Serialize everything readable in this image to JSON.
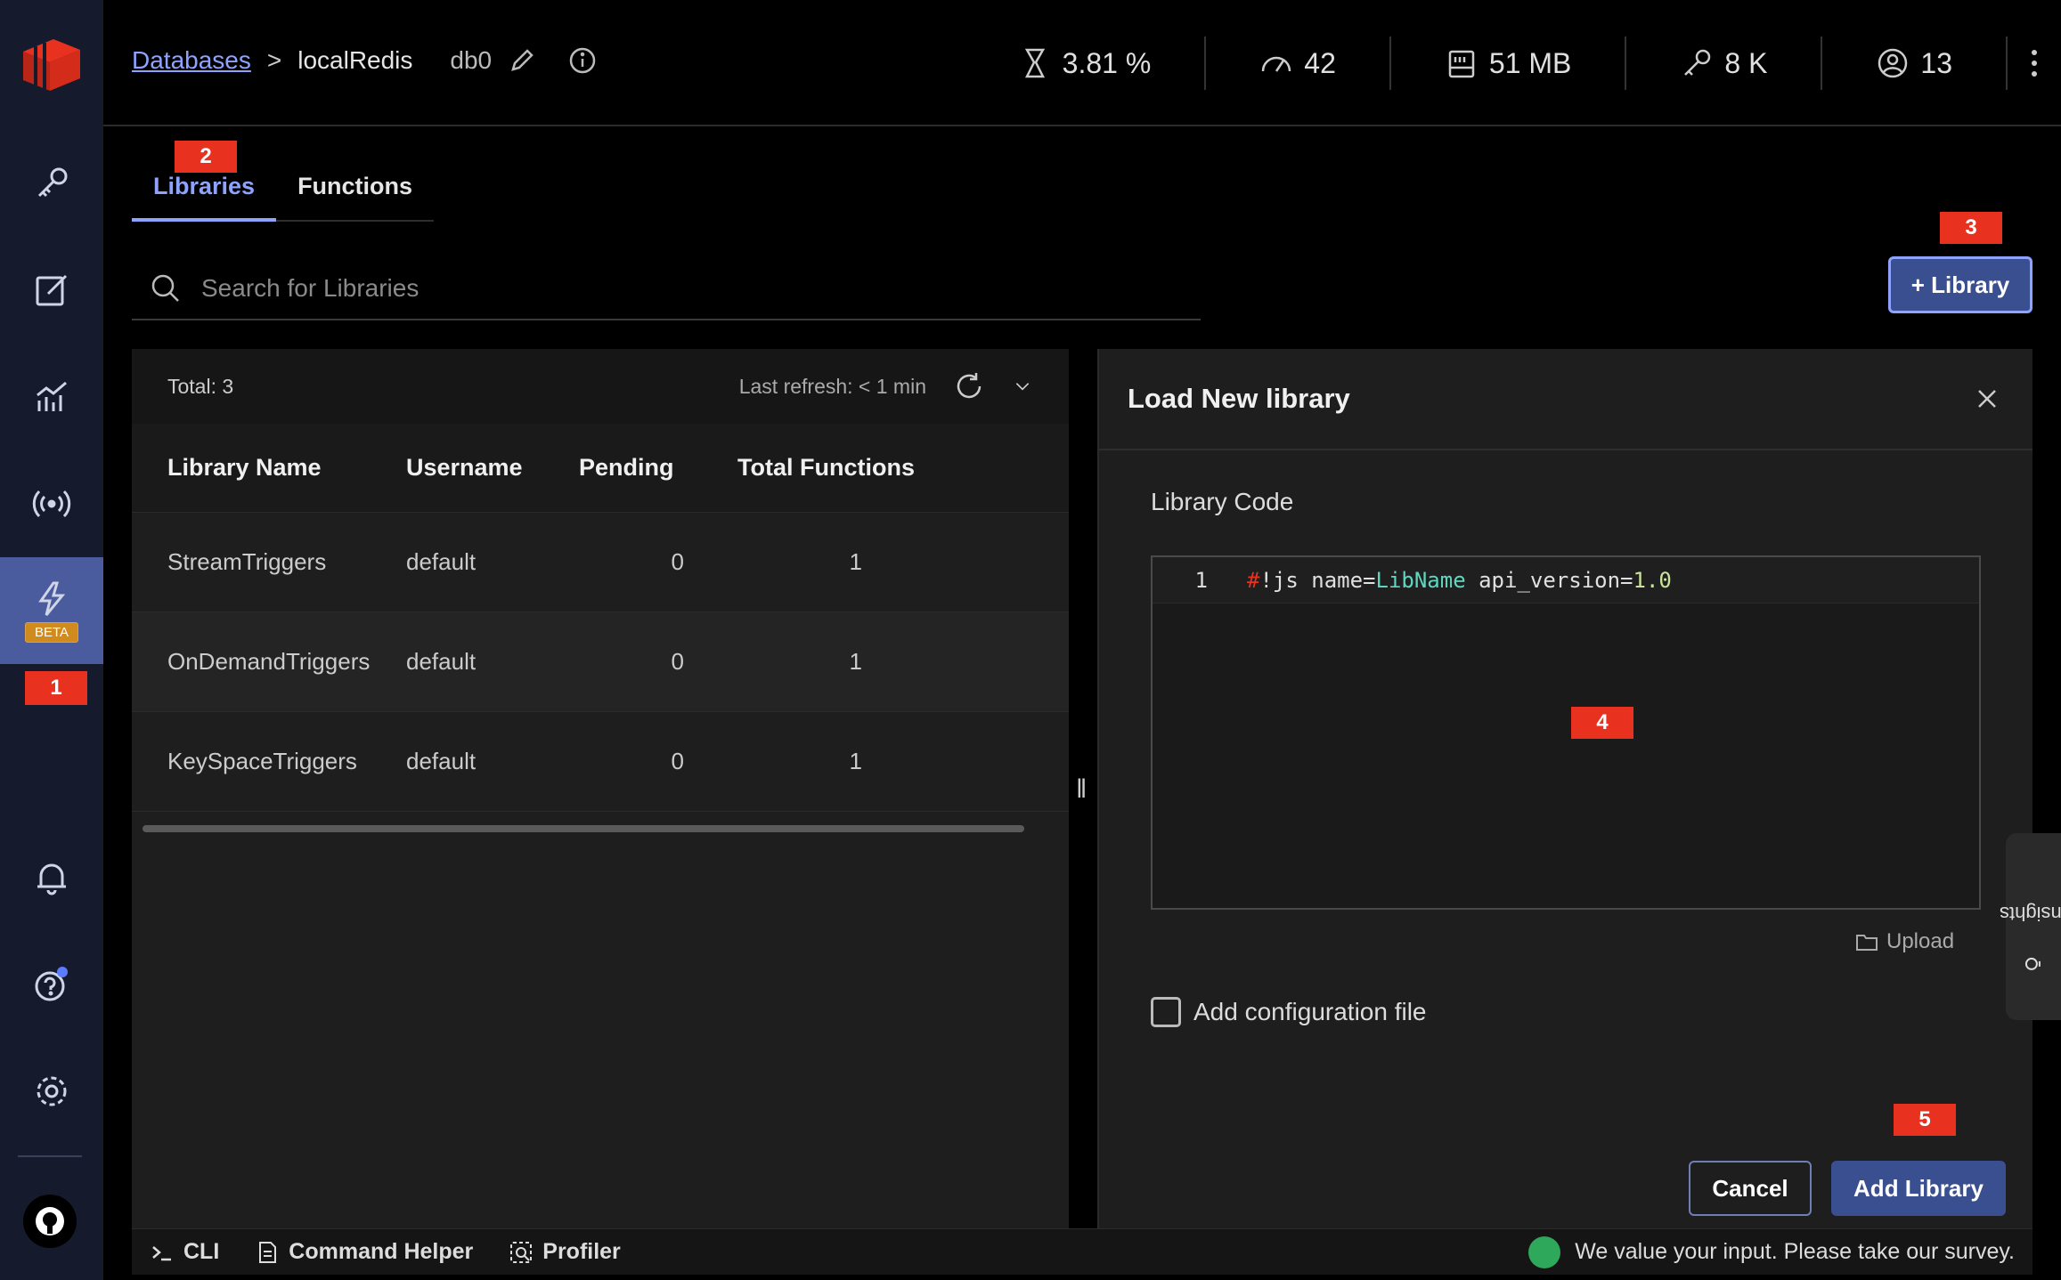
{
  "breadcrumb": {
    "databases_link": "Databases",
    "separator": ">",
    "db_name": "localRedis",
    "db_index": "db0"
  },
  "stats": [
    {
      "icon": "cpu-icon",
      "value": "3.81 %"
    },
    {
      "icon": "gauge-icon",
      "value": "42"
    },
    {
      "icon": "memory-icon",
      "value": "51 MB"
    },
    {
      "icon": "key-icon",
      "value": "8 K"
    },
    {
      "icon": "users-icon",
      "value": "13"
    }
  ],
  "tabs": [
    {
      "label": "Libraries",
      "active": true
    },
    {
      "label": "Functions",
      "active": false
    }
  ],
  "search": {
    "placeholder": "Search for Libraries"
  },
  "add_library_button": "+ Library",
  "list": {
    "total": "Total: 3",
    "last_refresh": "Last refresh: < 1 min",
    "columns": [
      "Library Name",
      "Username",
      "Pending",
      "Total Functions"
    ],
    "rows": [
      {
        "name": "StreamTriggers",
        "username": "default",
        "pending": "0",
        "total": "1"
      },
      {
        "name": "OnDemandTriggers",
        "username": "default",
        "pending": "0",
        "total": "1"
      },
      {
        "name": "KeySpaceTriggers",
        "username": "default",
        "pending": "0",
        "total": "1"
      }
    ]
  },
  "load_panel": {
    "title": "Load New library",
    "code_label": "Library Code",
    "line_number": "1",
    "code_hash": "#",
    "code_part1": "!js name=",
    "code_name": "LibName",
    "code_part2": " api_version=",
    "code_version": "1.0",
    "upload": "Upload",
    "config_checkbox": "Add configuration file",
    "cancel": "Cancel",
    "submit": "Add Library"
  },
  "insights": "Insights",
  "sidebar": {
    "beta_badge": "BETA"
  },
  "markers": [
    "1",
    "2",
    "3",
    "4",
    "5"
  ],
  "bottom": {
    "cli": "CLI",
    "command_helper": "Command Helper",
    "profiler": "Profiler",
    "survey": "We value your input. Please take our survey."
  },
  "colors": {
    "accent": "#8ea2ff",
    "marker": "#e8321f",
    "sidebar": "#151a2c",
    "primary_button": "#3a4f8f"
  }
}
